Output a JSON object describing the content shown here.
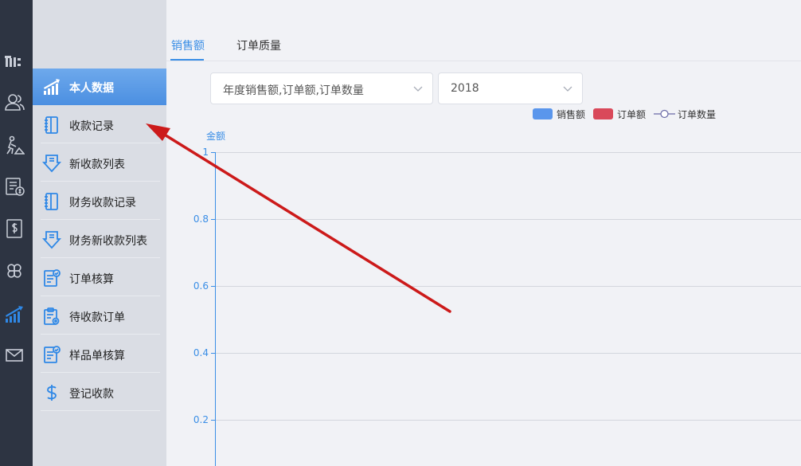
{
  "rail": {
    "icons": [
      {
        "name": "tools-icon"
      },
      {
        "name": "users-icon"
      },
      {
        "name": "worker-icon"
      },
      {
        "name": "invoice-icon"
      },
      {
        "name": "dollar-document-icon"
      },
      {
        "name": "clover-icon"
      },
      {
        "name": "stats-icon"
      },
      {
        "name": "mail-icon"
      }
    ]
  },
  "submenu": {
    "items": [
      {
        "label": "本人数据",
        "icon": "stats-bars-icon",
        "active": true
      },
      {
        "label": "收款记录",
        "icon": "notebook-icon"
      },
      {
        "label": "新收款列表",
        "icon": "download-icon"
      },
      {
        "label": "财务收款记录",
        "icon": "notebook-icon"
      },
      {
        "label": "财务新收款列表",
        "icon": "download-icon"
      },
      {
        "label": "订单核算",
        "icon": "checklist-icon"
      },
      {
        "label": "待收款订单",
        "icon": "clipboard-gear-icon"
      },
      {
        "label": "样品单核算",
        "icon": "checklist-icon"
      },
      {
        "label": "登记收款",
        "icon": "dollar-icon"
      }
    ]
  },
  "tabs": [
    {
      "label": "销售额",
      "active": true
    },
    {
      "label": "订单质量",
      "active": false
    }
  ],
  "filters": {
    "metric_select": "年度销售额,订单额,订单数量",
    "year_select": "2018"
  },
  "colors": {
    "accent": "#3a8ee6",
    "sales": "#5a96ec",
    "order_amount": "#d9495a",
    "order_count": "#6a6aa6",
    "annotation_arrow": "#cc1a1a"
  },
  "chart_data": {
    "type": "bar",
    "ylabel": "金额",
    "ylim": [
      0,
      1
    ],
    "yticks": [
      "1",
      "0.8",
      "0.6",
      "0.4",
      "0.2"
    ],
    "series": [
      {
        "name": "销售额",
        "values": []
      },
      {
        "name": "订单额",
        "values": []
      },
      {
        "name": "订单数量",
        "values": []
      }
    ],
    "legend": "top-right",
    "grid": true
  }
}
